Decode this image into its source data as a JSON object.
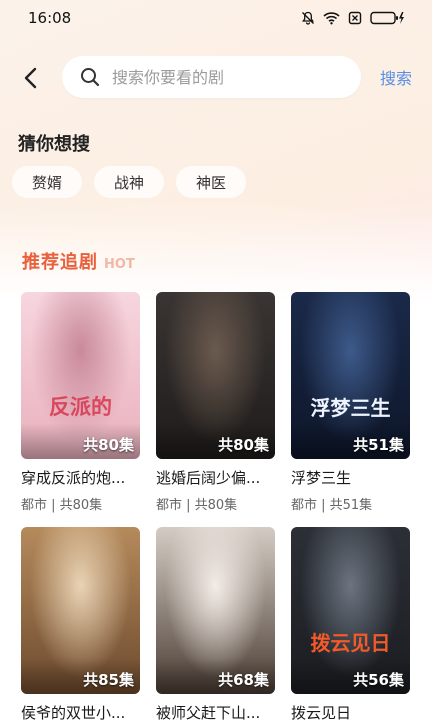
{
  "status": {
    "time": "16:08"
  },
  "search": {
    "placeholder": "搜索你要看的剧",
    "button_label": "搜索"
  },
  "suggest": {
    "title": "猜你想搜",
    "chips": [
      "赘婿",
      "战神",
      "神医"
    ]
  },
  "recommend": {
    "title": "推荐追剧",
    "tag": "HOT",
    "items": [
      {
        "name": "穿成反派的炮...",
        "meta": "都市 | 共80集",
        "episodes": "共80集",
        "art_text": "反派的",
        "palette": [
          "#f7d6df",
          "#c98a9a",
          "#e9b0bd"
        ]
      },
      {
        "name": "逃婚后阔少偏...",
        "meta": "都市 | 共80集",
        "episodes": "共80集",
        "art_text": "",
        "palette": [
          "#3a3533",
          "#6b5a4e",
          "#1e1b1a"
        ]
      },
      {
        "name": "浮梦三生",
        "meta": "都市 | 共51集",
        "episodes": "共51集",
        "art_text": "浮梦三生",
        "palette": [
          "#1b2a4a",
          "#3d5a8a",
          "#0d1528"
        ]
      },
      {
        "name": "侯爷的双世小...",
        "meta": "",
        "episodes": "共85集",
        "art_text": "",
        "palette": [
          "#b58a5c",
          "#e9d3b4",
          "#6d4a2e"
        ]
      },
      {
        "name": "被师父赶下山...",
        "meta": "",
        "episodes": "共68集",
        "art_text": "",
        "palette": [
          "#d4ccc4",
          "#f3ece6",
          "#4a3c33"
        ]
      },
      {
        "name": "拨云见日",
        "meta": "",
        "episodes": "共56集",
        "art_text": "拨云见日",
        "palette": [
          "#2c2f36",
          "#6b7480",
          "#1a1c20"
        ]
      }
    ]
  }
}
